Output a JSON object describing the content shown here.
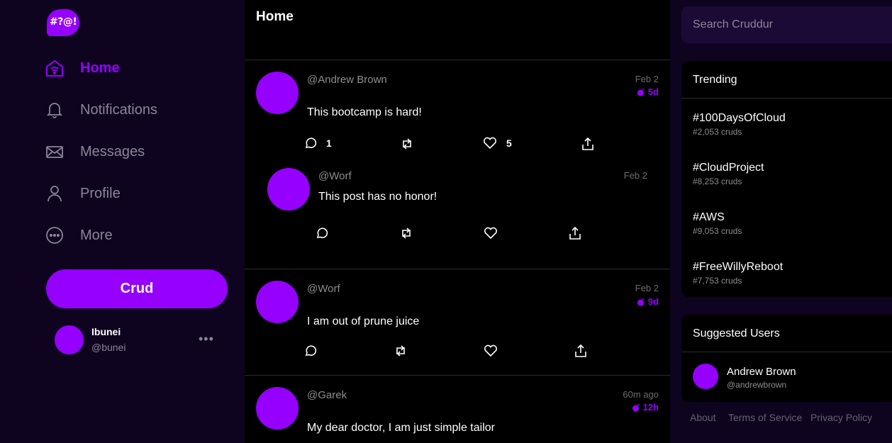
{
  "app": {
    "logo_text": "#?@!"
  },
  "nav": {
    "items": [
      {
        "label": "Home",
        "icon": "home-icon",
        "active": true
      },
      {
        "label": "Notifications",
        "icon": "bell-icon",
        "active": false
      },
      {
        "label": "Messages",
        "icon": "envelope-icon",
        "active": false
      },
      {
        "label": "Profile",
        "icon": "person-icon",
        "active": false
      },
      {
        "label": "More",
        "icon": "more-circle-icon",
        "active": false
      }
    ],
    "crud_button": "Crud",
    "user": {
      "name": "Ibunei",
      "handle": "@bunei",
      "menu": "•••"
    }
  },
  "feed": {
    "title": "Home",
    "posts": [
      {
        "handle": "@Andrew Brown",
        "message": "This bootcamp is hard!",
        "date": "Feb 2",
        "expires": "5d",
        "replies": "1",
        "likes": "5"
      },
      {
        "handle": "@Worf",
        "message": "This post has no honor!",
        "date": "Feb 2"
      },
      {
        "handle": "@Worf",
        "message": "I am out of prune juice",
        "date": "Feb 2",
        "expires": "9d"
      },
      {
        "handle": "@Garek",
        "message": "My dear doctor, I am just simple tailor",
        "date": "60m ago",
        "expires": "12h"
      }
    ]
  },
  "search": {
    "placeholder": "Search Cruddur"
  },
  "trending": {
    "title": "Trending",
    "items": [
      {
        "tag": "#100DaysOfCloud",
        "count": "#2,053 cruds"
      },
      {
        "tag": "#CloudProject",
        "count": "#8,253 cruds"
      },
      {
        "tag": "#AWS",
        "count": "#9,053 cruds"
      },
      {
        "tag": "#FreeWillyReboot",
        "count": "#7,753 cruds"
      }
    ]
  },
  "suggested": {
    "title": "Suggested Users",
    "users": [
      {
        "name": "Andrew Brown",
        "handle": "@andrewbrown"
      }
    ]
  },
  "footer": {
    "about": "About",
    "terms": "Terms of Service",
    "privacy": "Privacy Policy"
  },
  "colors": {
    "accent": "#9500ff",
    "nav_bg": "#0e0420",
    "feed_bg": "#000000"
  }
}
